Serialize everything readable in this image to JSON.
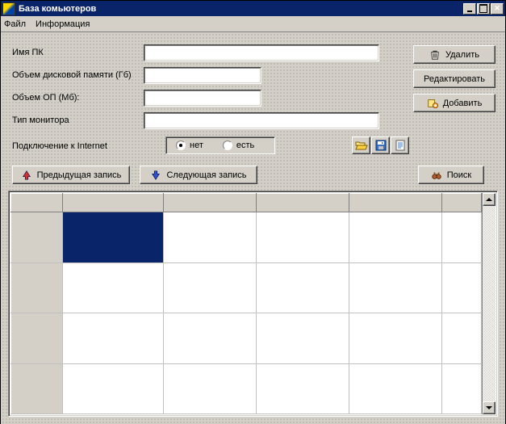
{
  "window": {
    "title": "База комьютеров"
  },
  "menu": {
    "file": "Файл",
    "info": "Информация"
  },
  "form": {
    "pc_name_label": "Имя ПК",
    "disk_label": "Объем дисковой памяти (Гб)",
    "ram_label": "Объем ОП (Мб):",
    "monitor_label": "Тип  монитора",
    "internet_label": "Подключение к Internet",
    "pc_name_value": "",
    "disk_value": "",
    "ram_value": "",
    "monitor_value": ""
  },
  "radio": {
    "no": "нет",
    "yes": "есть",
    "selected": "no"
  },
  "buttons": {
    "delete": "Удалить",
    "edit": "Редактировать",
    "add": "Добавить",
    "prev": "Предыдущая запись",
    "next": "Следующая запись",
    "search": "Поиск"
  },
  "icon_buttons": {
    "open": "open-folder-icon",
    "save": "floppy-icon",
    "report": "report-icon"
  },
  "grid": {
    "columns": [
      "",
      "",
      "",
      "",
      "",
      ""
    ],
    "rows": 4,
    "selected_row": 0,
    "selected_col": 1
  }
}
